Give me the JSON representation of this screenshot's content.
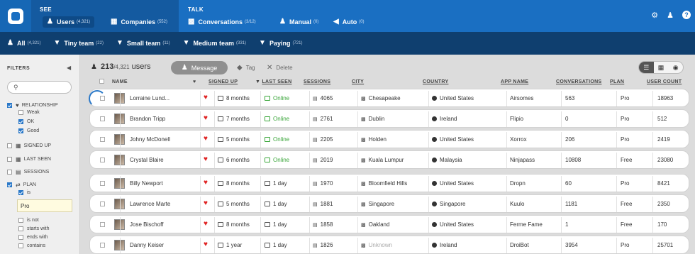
{
  "header": {
    "see_label": "SEE",
    "talk_label": "TALK",
    "tabs": [
      {
        "label": "Users",
        "count": "(4,321)"
      },
      {
        "label": "Companies",
        "count": "(552)"
      },
      {
        "label": "Conversations",
        "count": "(3/12)"
      },
      {
        "label": "Manual",
        "count": "(0)"
      },
      {
        "label": "Auto",
        "count": "(0)"
      }
    ]
  },
  "segments": [
    {
      "label": "All",
      "count": "(4,321)"
    },
    {
      "label": "Tiny team",
      "count": "(22)"
    },
    {
      "label": "Small team",
      "count": "(11)"
    },
    {
      "label": "Medium team",
      "count": "(331)"
    },
    {
      "label": "Paying",
      "count": "(721)"
    }
  ],
  "sidebar": {
    "title": "FILTERS",
    "relationship": "RELATIONSHIP",
    "weak": "Weak",
    "ok": "OK",
    "good": "Good",
    "signed_up": "SIGNED UP",
    "last_seen": "LAST SEEN",
    "sessions": "SESSIONS",
    "plan": "PLAN",
    "is": "is",
    "plan_value": "Pro",
    "is_not": "is not",
    "starts_with": "starts with",
    "ends_with": "ends with",
    "contains": "contains"
  },
  "toolbar": {
    "count": "213",
    "total": "/4,321",
    "unit": "users",
    "message": "Message",
    "tag": "Tag",
    "delete": "Delete"
  },
  "columns": {
    "name": "NAME",
    "signed_up": "SIGNED UP",
    "last_seen": "LAST SEEN",
    "sessions": "SESSIONS",
    "city": "CITY",
    "country": "COUNTRY",
    "app_name": "APP NAME",
    "conversations": "CONVERSATIONS",
    "plan": "PLAN",
    "user_count": "USER COUNT"
  },
  "users": [
    {
      "name": "Lorraine Lund...",
      "signed_up": "8 months",
      "last_seen": "Online",
      "sessions": "4065",
      "city": "Chesapeake",
      "country": "United States",
      "app": "Airsomes",
      "conversations": "563",
      "plan": "Pro",
      "user_count": "18963"
    },
    {
      "name": "Brandon Tripp",
      "signed_up": "7 months",
      "last_seen": "Online",
      "sessions": "2761",
      "city": "Dublin",
      "country": "Ireland",
      "app": "Flipio",
      "conversations": "0",
      "plan": "Pro",
      "user_count": "512"
    },
    {
      "name": "Johny McDonell",
      "signed_up": "5 months",
      "last_seen": "Online",
      "sessions": "2205",
      "city": "Holden",
      "country": "United States",
      "app": "Xorrox",
      "conversations": "206",
      "plan": "Pro",
      "user_count": "2419"
    },
    {
      "name": "Crystal Blaire",
      "signed_up": "6 months",
      "last_seen": "Online",
      "sessions": "2019",
      "city": "Kuala Lumpur",
      "country": "Malaysia",
      "app": "Ninjapass",
      "conversations": "10808",
      "plan": "Free",
      "user_count": "23080"
    },
    {
      "name": "Billy Newport",
      "signed_up": "8 months",
      "last_seen": "1 day",
      "sessions": "1970",
      "city": "Bloomfield Hills",
      "country": "United States",
      "app": "Dropn",
      "conversations": "60",
      "plan": "Pro",
      "user_count": "8421"
    },
    {
      "name": "Lawrence Marte",
      "signed_up": "5 months",
      "last_seen": "1 day",
      "sessions": "1881",
      "city": "Singapore",
      "country": "Singapore",
      "app": "Kuulo",
      "conversations": "1181",
      "plan": "Free",
      "user_count": "2350"
    },
    {
      "name": "Jose Bischoff",
      "signed_up": "8 months",
      "last_seen": "1 day",
      "sessions": "1858",
      "city": "Oakland",
      "country": "United States",
      "app": "Ferme Fame",
      "conversations": "1",
      "plan": "Free",
      "user_count": "170"
    },
    {
      "name": "Danny Keiser",
      "signed_up": "1 year",
      "last_seen": "1 day",
      "sessions": "1826",
      "city": "Unknown",
      "country": "Ireland",
      "app": "DroiBot",
      "conversations": "3954",
      "plan": "Pro",
      "user_count": "25701"
    }
  ],
  "colors": {
    "brand": "#1a6fc2",
    "segbar": "#0f3f6f",
    "online": "#3aa63a",
    "heart": "#e02424"
  }
}
